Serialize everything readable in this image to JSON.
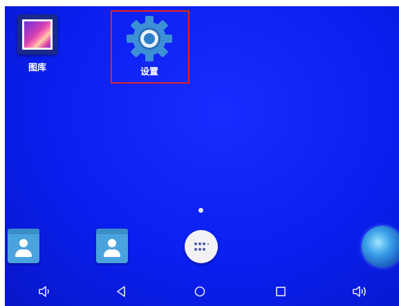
{
  "apps": {
    "gallery": {
      "label": "图库",
      "icon": "gallery-icon"
    },
    "settings": {
      "label": "设置",
      "icon": "gear-icon"
    }
  },
  "dock": {
    "items": [
      {
        "name": "contacts",
        "icon": "contacts-icon"
      },
      {
        "name": "contacts",
        "icon": "contacts-icon"
      },
      {
        "name": "app-drawer",
        "icon": "app-drawer-icon"
      },
      {
        "name": "browser",
        "icon": "globe-icon"
      }
    ]
  },
  "navbar": {
    "buttons": [
      "volume-down-icon",
      "back-icon",
      "home-icon",
      "recents-icon",
      "volume-up-icon"
    ]
  },
  "colors": {
    "wallpaper": "#0a1ff0",
    "highlight": "#e8241b",
    "gear": "#3d8fd6"
  }
}
